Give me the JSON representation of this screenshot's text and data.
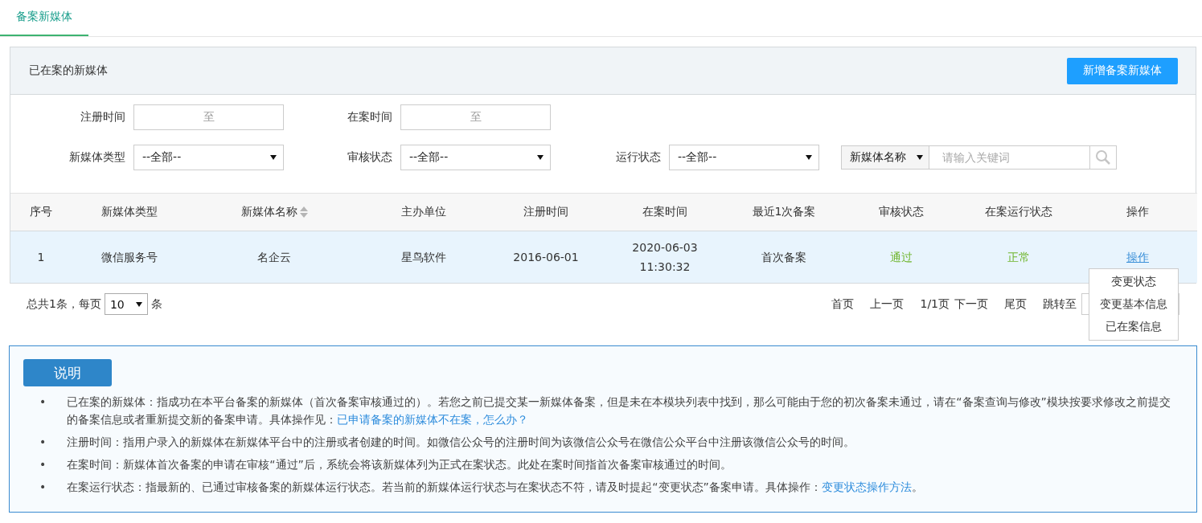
{
  "tab": {
    "label": "备案新媒体",
    "selected": true
  },
  "panel": {
    "title": "已在案的新媒体",
    "add_button": "新增备案新媒体"
  },
  "filters": {
    "date_ranges": [
      {
        "label": "注册时间",
        "separator": "至"
      },
      {
        "label": "在案时间",
        "separator": "至"
      }
    ],
    "selects": [
      {
        "label": "新媒体类型",
        "value": "--全部--"
      },
      {
        "label": "审核状态",
        "value": "--全部--"
      },
      {
        "label": "运行状态",
        "value": "--全部--"
      }
    ],
    "search": {
      "field": "新媒体名称",
      "placeholder": "请输入关键词"
    }
  },
  "table": {
    "columns": [
      {
        "label": "序号",
        "sortable": false
      },
      {
        "label": "新媒体类型",
        "sortable": false
      },
      {
        "label": "新媒体名称",
        "sortable": true
      },
      {
        "label": "主办单位",
        "sortable": false
      },
      {
        "label": "注册时间",
        "sortable": false
      },
      {
        "label": "在案时间",
        "sortable": false
      },
      {
        "label": "最近1次备案",
        "sortable": false
      },
      {
        "label": "审核状态",
        "sortable": false
      },
      {
        "label": "在案运行状态",
        "sortable": false
      },
      {
        "label": "操作",
        "sortable": false
      }
    ],
    "rows": [
      {
        "selected": true,
        "cells": [
          {
            "kind": "text",
            "text": "1"
          },
          {
            "kind": "text",
            "text": "微信服务号"
          },
          {
            "kind": "text",
            "text": "名企云"
          },
          {
            "kind": "text",
            "text": "星鸟软件"
          },
          {
            "kind": "text",
            "text": "2016-06-01"
          },
          {
            "kind": "datetime",
            "text": "2020-06-03",
            "second_line": "11:30:32"
          },
          {
            "kind": "text",
            "text": "首次备案"
          },
          {
            "kind": "status",
            "text": "通过"
          },
          {
            "kind": "status",
            "text": "正常"
          },
          {
            "kind": "link",
            "text": "操作"
          }
        ]
      }
    ]
  },
  "row_menu": {
    "items": [
      "变更状态",
      "变更基本信息",
      "已在案信息"
    ]
  },
  "pagination": {
    "summary": "总共1条，每页",
    "page_size": "10",
    "unit": "条",
    "items": [
      {
        "kind": "link",
        "text": "首页"
      },
      {
        "kind": "link",
        "text": "上一页"
      },
      {
        "kind": "text",
        "text": "1/1页"
      },
      {
        "kind": "link",
        "text": "下一页"
      },
      {
        "kind": "link",
        "text": "尾页"
      }
    ],
    "jump_label": "跳转至"
  },
  "notes": {
    "button": "说明",
    "items": [
      {
        "marker": "•",
        "text": "已在案的新媒体：指成功在本平台备案的新媒体（首次备案审核通过的）。若您之前已提交某一新媒体备案，但是未在本模块列表中找到，那么可能由于您的初次备案未通过，请在“备案查询与修改”模块按要求修改之前提交的备案信息或者重新提交新的备案申请。具体操作见：",
        "link": "已申请备案的新媒体不在案，怎么办？"
      },
      {
        "marker": "•",
        "text": "注册时间：指用户录入的新媒体在新媒体平台中的注册或者创建的时间。如微信公众号的注册时间为该微信公众号在微信公众平台中注册该微信公众号的时间。"
      },
      {
        "marker": "•",
        "text": "在案时间：新媒体首次备案的申请在审核“通过”后，系统会将该新媒体列为正式在案状态。此处在案时间指首次备案审核通过的时间。"
      },
      {
        "marker": "•",
        "text": "在案运行状态：指最新的、已通过审核备案的新媒体运行状态。若当前的新媒体运行状态与在案状态不符，请及时提起“变更状态”备案申请。具体操作：",
        "link": "变更状态操作方法",
        "after": "。"
      }
    ]
  }
}
